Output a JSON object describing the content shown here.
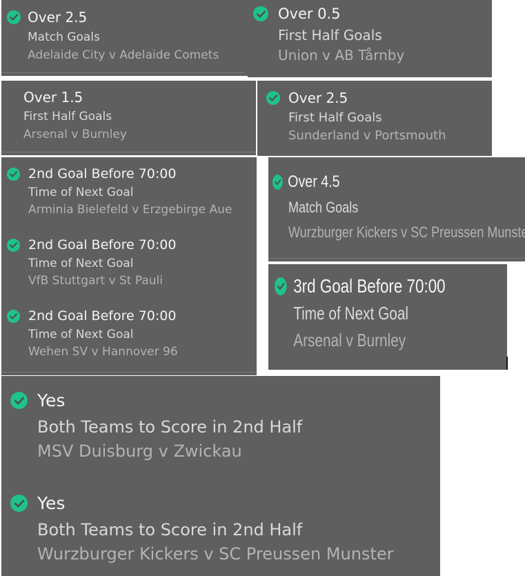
{
  "bets": [
    {
      "selection": "Over 2.5",
      "market": "Match Goals",
      "event": "Adelaide City v Adelaide Comets"
    },
    {
      "selection": "Over 0.5",
      "market": "First Half Goals",
      "event": "Union v AB Tårnby"
    },
    {
      "selection": "Over 1.5",
      "market": "First Half Goals",
      "event": "Arsenal v Burnley"
    },
    {
      "selection": "Over 2.5",
      "market": "First Half Goals",
      "event": "Sunderland v Portsmouth"
    },
    {
      "selection": "2nd Goal Before 70:00",
      "market": "Time of Next Goal",
      "event": "Arminia Bielefeld v Erzgebirge Aue"
    },
    {
      "selection": "2nd Goal Before 70:00",
      "market": "Time of Next Goal",
      "event": "VfB Stuttgart v St Pauli"
    },
    {
      "selection": "2nd Goal Before 70:00",
      "market": "Time of Next Goal",
      "event": "Wehen SV v Hannover 96"
    },
    {
      "selection": "Over 4.5",
      "market": "Match Goals",
      "event": "Wurzburger Kickers v SC Preussen Munster"
    },
    {
      "selection": "3rd Goal Before 70:00",
      "market": "Time of Next Goal",
      "event": "Arsenal v Burnley"
    },
    {
      "selection": "Yes",
      "market": "Both Teams to Score in 2nd Half",
      "event": "MSV Duisburg v Zwickau"
    },
    {
      "selection": "Yes",
      "market": "Both Teams to Score in 2nd Half",
      "event": "Wurzburger Kickers v SC Preussen Munster"
    }
  ],
  "colors": {
    "card": "#5f5f5f",
    "check": "#1fc28a",
    "selection": "#f4f4f4",
    "market": "#d9d9d9",
    "event": "#b3b3b3"
  }
}
